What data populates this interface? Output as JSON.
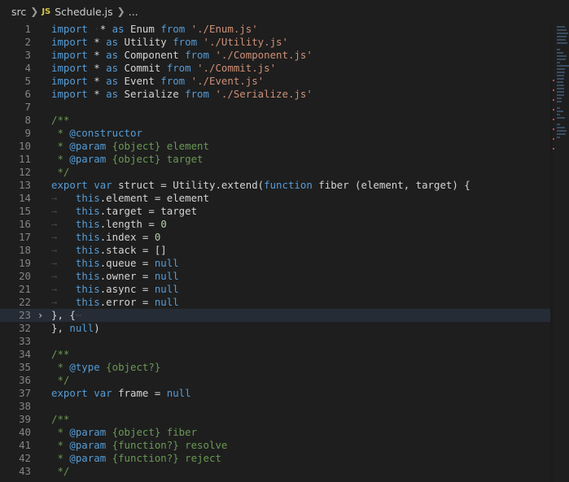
{
  "breadcrumb": {
    "folder": "src",
    "file_badge": "JS",
    "file": "Schedule.js",
    "more": "..."
  },
  "lines": [
    {
      "n": "1",
      "html": "<span class='imp'>import</span> <span class='ws'>·</span>* <span class='imp'>as</span> Enum <span class='imp'>from</span> <span class='str'>'./Enum.js'</span>"
    },
    {
      "n": "2",
      "html": "<span class='imp'>import</span> * <span class='imp'>as</span> Utility <span class='imp'>from</span> <span class='str'>'./Utility.js'</span>"
    },
    {
      "n": "3",
      "html": "<span class='imp'>import</span> * <span class='imp'>as</span> Component <span class='imp'>from</span> <span class='str'>'./Component.js'</span>"
    },
    {
      "n": "4",
      "html": "<span class='imp'>import</span> * <span class='imp'>as</span> Commit <span class='imp'>from</span> <span class='str'>'./Commit.js'</span>"
    },
    {
      "n": "5",
      "html": "<span class='imp'>import</span> * <span class='imp'>as</span> Event <span class='imp'>from</span> <span class='str'>'./Event.js'</span>"
    },
    {
      "n": "6",
      "html": "<span class='imp'>import</span> * <span class='imp'>as</span> Serialize <span class='imp'>from</span> <span class='str'>'./Serialize.js'</span>"
    },
    {
      "n": "7",
      "html": ""
    },
    {
      "n": "8",
      "html": "<span class='cmt'>/**</span>"
    },
    {
      "n": "9",
      "html": "<span class='cmt'> * </span><span class='kw'>@constructor</span>"
    },
    {
      "n": "10",
      "html": "<span class='cmt'> * </span><span class='kw'>@param</span> <span class='cmt'>{object} element</span>"
    },
    {
      "n": "11",
      "html": "<span class='cmt'> * </span><span class='kw'>@param</span> <span class='cmt'>{object} target</span>"
    },
    {
      "n": "12",
      "html": "<span class='cmt'> */</span>"
    },
    {
      "n": "13",
      "html": "<span class='kw'>export</span> <span class='kw'>var</span> struct = Utility.extend(<span class='kw'>function</span> fiber (element, target) {"
    },
    {
      "n": "14",
      "html": "<span class='guide'>→</span>   <span class='kw'>this</span>.element = element"
    },
    {
      "n": "15",
      "html": "<span class='guide'>→</span>   <span class='kw'>this</span>.target = target"
    },
    {
      "n": "16",
      "html": "<span class='guide'>→</span>   <span class='kw'>this</span>.length = <span class='num'>0</span>"
    },
    {
      "n": "17",
      "html": "<span class='guide'>→</span>   <span class='kw'>this</span>.index = <span class='num'>0</span>"
    },
    {
      "n": "18",
      "html": "<span class='guide'>→</span>   <span class='kw'>this</span>.stack = []"
    },
    {
      "n": "19",
      "html": "<span class='guide'>→</span>   <span class='kw'>this</span>.queue = <span class='kw'>null</span>"
    },
    {
      "n": "20",
      "html": "<span class='guide'>→</span>   <span class='kw'>this</span>.owner = <span class='kw'>null</span>"
    },
    {
      "n": "21",
      "html": "<span class='guide'>→</span>   <span class='kw'>this</span>.async = <span class='kw'>null</span>"
    },
    {
      "n": "22",
      "html": "<span class='guide'>→</span>   <span class='kw'>this</span>.error = <span class='kw'>null</span>"
    },
    {
      "n": "23",
      "html": "}, {<span class='guide'>⋯</span>",
      "fold": "›",
      "current": true
    },
    {
      "n": "32",
      "html": "}, <span class='kw'>null</span>)"
    },
    {
      "n": "33",
      "html": ""
    },
    {
      "n": "34",
      "html": "<span class='cmt'>/**</span>"
    },
    {
      "n": "35",
      "html": "<span class='cmt'> * </span><span class='kw'>@type</span> <span class='cmt'>{object?}</span>"
    },
    {
      "n": "36",
      "html": "<span class='cmt'> */</span>"
    },
    {
      "n": "37",
      "html": "<span class='kw'>export</span> <span class='kw'>var</span> frame = <span class='kw'>null</span>"
    },
    {
      "n": "38",
      "html": ""
    },
    {
      "n": "39",
      "html": "<span class='cmt'>/**</span>"
    },
    {
      "n": "40",
      "html": "<span class='cmt'> * </span><span class='kw'>@param</span> <span class='cmt'>{object} fiber</span>"
    },
    {
      "n": "41",
      "html": "<span class='cmt'> * </span><span class='kw'>@param</span> <span class='cmt'>{function?} resolve</span>"
    },
    {
      "n": "42",
      "html": "<span class='cmt'> * </span><span class='kw'>@param</span> <span class='cmt'>{function?} reject</span>"
    },
    {
      "n": "43",
      "html": "<span class='cmt'> */</span>"
    }
  ],
  "colors": {
    "background": "#1e1e1e",
    "keyword": "#569cd6",
    "string": "#ce9178",
    "number": "#b5cea8",
    "comment": "#6a9955",
    "line_number": "#858585",
    "current_line": "#262c36"
  }
}
